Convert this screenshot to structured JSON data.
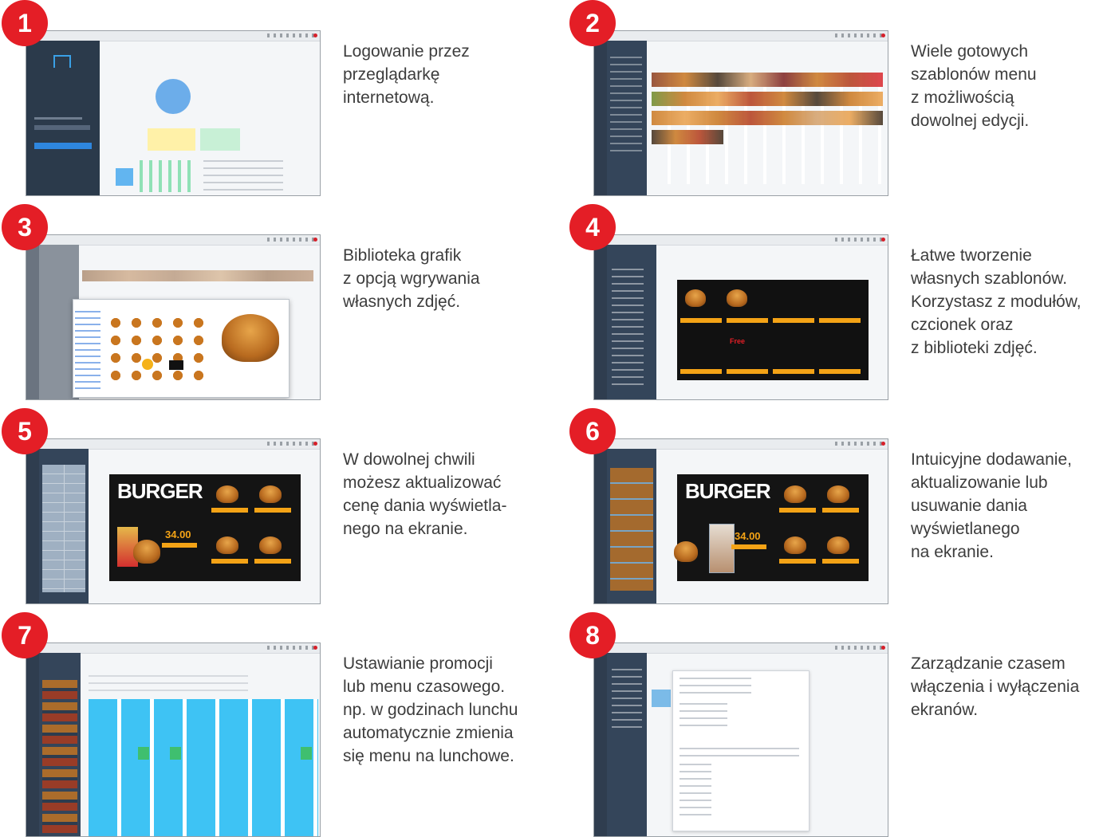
{
  "accent_color": "#e41e26",
  "steps": [
    {
      "number": "1",
      "text": "Logowanie przez\nprzeglądarkę\ninternetową."
    },
    {
      "number": "2",
      "text": "Wiele gotowych\nszablonów menu\nz możliwością\ndowolnej edycji."
    },
    {
      "number": "3",
      "text": "Biblioteka grafik\nz opcją wgrywania\nwłasnych zdjęć."
    },
    {
      "number": "4",
      "text": "Łatwe tworzenie\nwłasnych szablonów.\nKorzystasz z modułów,\nczcionek oraz\nz biblioteki zdjęć."
    },
    {
      "number": "5",
      "text": "W dowolnej chwili\nmożesz aktualizować\ncenę dania wyświetla-\nnego na ekranie."
    },
    {
      "number": "6",
      "text": "Intuicyjne dodawanie,\naktualizowanie lub\nusuwanie dania\nwyświetlanego\nna ekranie."
    },
    {
      "number": "7",
      "text": "Ustawianie promocji\nlub menu czasowego.\nnp. w godzinach lunchu\nautomatycznie zmienia\nsię menu na lunchowe."
    },
    {
      "number": "8",
      "text": "Zarządzanie czasem\nwłączenia i wyłączenia\nekranów."
    }
  ],
  "screens": {
    "burger_title": "BURGER",
    "price": "34.00",
    "free_label": "Free"
  }
}
